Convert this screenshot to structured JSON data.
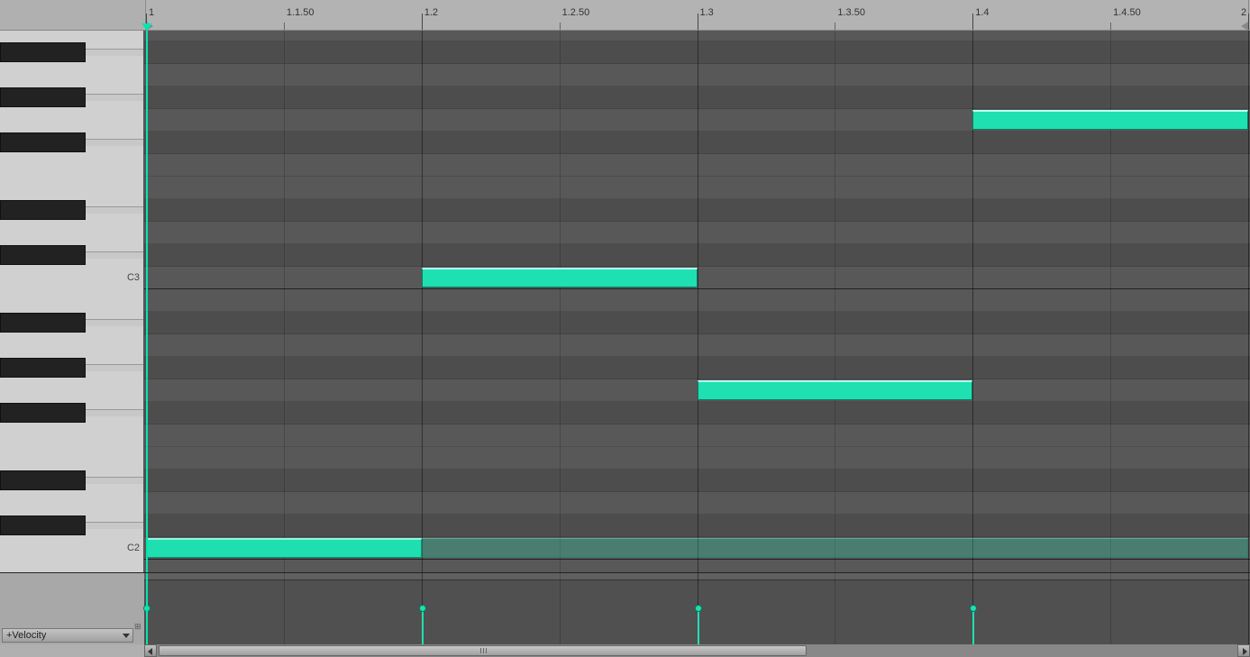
{
  "ruler": {
    "labels": [
      "1",
      "1.1.50",
      "1.2",
      "1.2.50",
      "1.3",
      "1.3.50",
      "1.4",
      "1.4.50",
      "2"
    ]
  },
  "piano": {
    "labels": {
      "C2": "C2",
      "C3": "C3"
    }
  },
  "lane": {
    "selector_label": "+Velocity"
  },
  "colors": {
    "note": "#1fe0b0",
    "playhead": "#00e6b0"
  },
  "chart_data": {
    "type": "table",
    "description": "MIDI piano-roll clip, one bar (1..2), four-note arpeggio plus a sustained background note",
    "time_range": {
      "start": "1.1",
      "end": "2.1"
    },
    "beats_visible": 4,
    "notes": [
      {
        "pitch": "C2",
        "start_beat": 1.0,
        "end_beat": 2.0,
        "velocity": 80
      },
      {
        "pitch": "C2",
        "start_beat": 1.0,
        "end_beat": 5.0,
        "velocity": 40,
        "ghost": true
      },
      {
        "pitch": "C3",
        "start_beat": 2.0,
        "end_beat": 3.0,
        "velocity": 80
      },
      {
        "pitch": "G2",
        "start_beat": 3.0,
        "end_beat": 4.0,
        "velocity": 80
      },
      {
        "pitch": "G3",
        "start_beat": 4.0,
        "end_beat": 5.0,
        "velocity": 80
      }
    ],
    "velocity_lane": [
      {
        "beat": 1.0,
        "velocity": 80
      },
      {
        "beat": 2.0,
        "velocity": 80
      },
      {
        "beat": 3.0,
        "velocity": 80
      },
      {
        "beat": 4.0,
        "velocity": 80
      }
    ],
    "pitch_rows_visible_top_to_bottom": [
      "C4",
      "B3",
      "A#3",
      "A3",
      "G#3",
      "G3",
      "F#3",
      "F3",
      "E3",
      "D#3",
      "D3",
      "C#3",
      "C3",
      "B2",
      "A#2",
      "A2",
      "G#2",
      "G2",
      "F#2",
      "F2",
      "E2",
      "D#2",
      "D2",
      "C#2",
      "C2",
      "B1",
      "A#1"
    ]
  }
}
